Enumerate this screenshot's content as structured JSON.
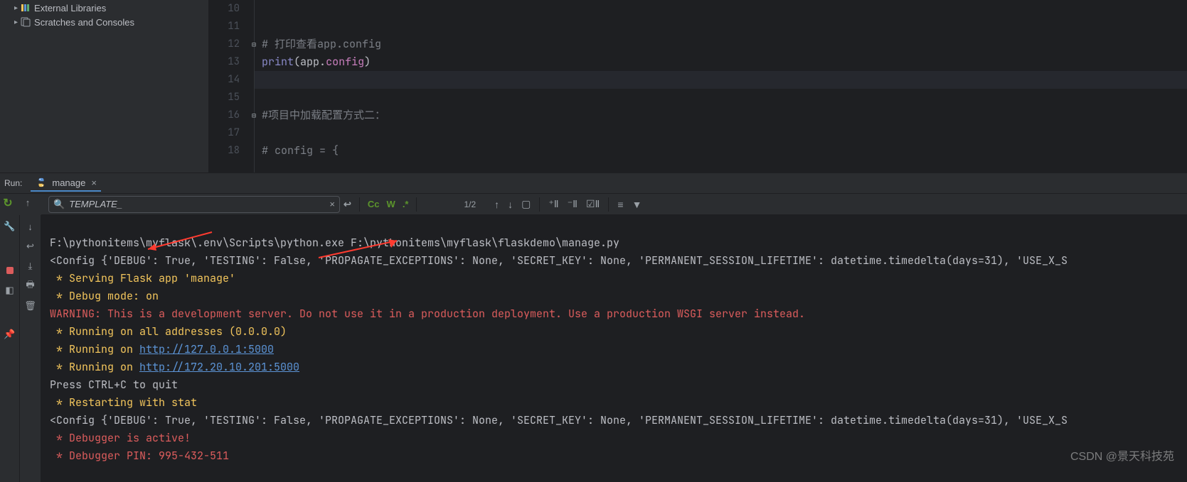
{
  "project_tree": {
    "external_libraries": "External Libraries",
    "scratches": "Scratches and Consoles"
  },
  "editor": {
    "lines": {
      "l10": "",
      "l11": "",
      "l12_comment": "# 打印查看app.config",
      "l13_print": "print",
      "l13_paren_open": "(",
      "l13_app": "app",
      "l13_dot": ".",
      "l13_config": "config",
      "l13_paren_close": ")",
      "l14": "",
      "l15": "",
      "l16_comment": "#项目中加载配置方式二：",
      "l17": "",
      "l18_comment": "# config = {"
    },
    "gutter": {
      "n10": "10",
      "n11": "11",
      "n12": "12",
      "n13": "13",
      "n14": "14",
      "n15": "15",
      "n16": "16",
      "n17": "17",
      "n18": "18"
    }
  },
  "run": {
    "label": "Run:",
    "tab_name": "manage"
  },
  "search": {
    "value": "TEMPLATE_",
    "match_count": "1/2",
    "cc": "Cc",
    "w": "W",
    "regex_dot": ".*"
  },
  "console": {
    "cmd": "F:\\pythonitems\\myflask\\.env\\Scripts\\python.exe F:\\pythonitems\\myflask\\flaskdemo\\manage.py",
    "config_line": "<Config {'DEBUG': True, 'TESTING': False, 'PROPAGATE_EXCEPTIONS': None, 'SECRET_KEY': None, 'PERMANENT_SESSION_LIFETIME': datetime.timedelta(days=31), 'USE_X_S",
    "serving": " * Serving Flask app 'manage'",
    "debug_mode": " * Debug mode: on",
    "warning": "WARNING: This is a development server. Do not use it in a production deployment. Use a production WSGI server instead.",
    "run_all": " * Running on all addresses (0.0.0.0)",
    "run_on_prefix": " * Running on ",
    "url1": "http://127.0.0.1:5000",
    "url2": "http://172.20.10.201:5000",
    "ctrl_c": "Press CTRL+C to quit",
    "restarting": " * Restarting with stat",
    "debugger_active": " * Debugger is active!",
    "debugger_pin": " * Debugger PIN: 995-432-511"
  },
  "watermark": "CSDN @景天科技苑"
}
